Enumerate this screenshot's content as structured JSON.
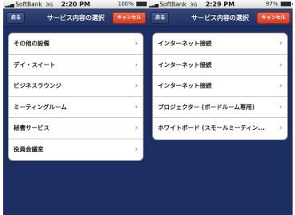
{
  "left_screen": {
    "status": {
      "carrier": "SoftBank",
      "network": "3G",
      "time": "2:20 PM",
      "battery_text": "100%",
      "battery_level": 1.0
    },
    "nav": {
      "back_label": "戻る",
      "title": "サービス内容の選択",
      "cancel_label": "キャンセル"
    },
    "items": [
      {
        "label": "その他の設備"
      },
      {
        "label": "デイ・スイート"
      },
      {
        "label": "ビジネスラウンジ"
      },
      {
        "label": "ミーティングルーム"
      },
      {
        "label": "秘書サービス"
      },
      {
        "label": "役員会議室"
      }
    ]
  },
  "right_screen": {
    "status": {
      "carrier": "SoftBank",
      "network": "3G",
      "time": "2:29 PM",
      "battery_text": "97%",
      "battery_level": 0.97
    },
    "nav": {
      "back_label": "戻る",
      "title": "サービス内容の選択",
      "cancel_label": "キャンセル"
    },
    "items": [
      {
        "label": "インターネット接続"
      },
      {
        "label": "インターネット接続"
      },
      {
        "label": "インターネット接続"
      },
      {
        "label": "プロジェクター (ボードルーム専用)"
      },
      {
        "label": "ホワイトボード (スモールミーティン..."
      }
    ]
  },
  "icons": {
    "signal": "signal-bars-icon",
    "battery": "battery-icon",
    "chevron": "chevron-right-icon"
  }
}
